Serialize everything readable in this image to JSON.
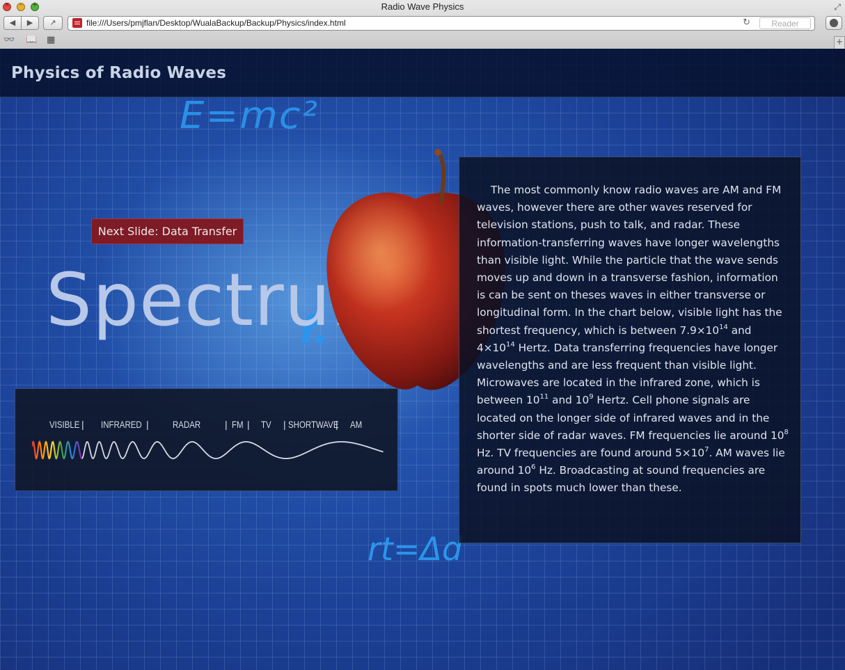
{
  "window": {
    "title": "Radio Wave Physics",
    "url": "file:///Users/pmjflan/Desktop/WualaBackup/Backup/Physics/index.html",
    "reader_label": "Reader"
  },
  "page": {
    "site_title": "Physics of Radio Waves",
    "next_slide_label": "Next Slide: Data Transfer",
    "spectrum_heading": "Spectrum",
    "formulas": {
      "emc2": "E=mc²",
      "f": "f.",
      "rt": "rt=Δd"
    },
    "spectrum_labels": {
      "visible": "VISIBLE",
      "infrared": "INFRARED",
      "radar": "RADAR",
      "fm": "FM",
      "tv": "TV",
      "shortwave": "SHORTWAVE",
      "am": "AM"
    },
    "body": {
      "s1": "The most commonly know radio waves are AM and FM waves, however there are other waves reserved for television stations, push to talk, and radar. These information-transferring waves have longer wavelengths than visible light. While the particle that the wave sends moves up and down in a transverse fashion, information is can be sent on theses waves in either transverse or longitudinal form. In the chart below, visible light has the shortest frequency, which is between 7.9×10",
      "e1": "14",
      "s2": " and 4×10",
      "e2": "14",
      "s3": " Hertz. Data transferring frequencies have longer wavelengths and are less frequent than visible light. Microwaves are located in the infrared zone, which is between 10",
      "e3": "11",
      "s4": " and 10",
      "e4": "9",
      "s5": " Hertz. Cell phone signals are located on the longer side of infrared waves and in the shorter side of radar waves. FM frequencies lie around 10",
      "e5": "8",
      "s6": " Hz. TV frequencies are found around 5×10",
      "e6": "7",
      "s7": ". AM waves lie around 10",
      "e7": "6",
      "s8": " Hz. Broadcasting at sound frequencies are found in spots much lower than these."
    }
  },
  "colors": {
    "background": "#1c3f8c",
    "formula_blue": "#2b8fe6",
    "next_button": "#7d1b26",
    "panel": "#0a1224"
  }
}
